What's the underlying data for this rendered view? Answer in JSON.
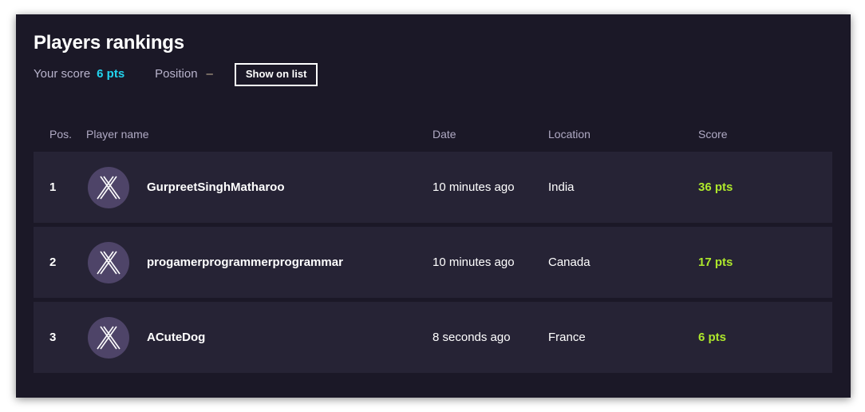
{
  "header": {
    "title": "Players rankings",
    "score_label": "Your score",
    "score_value": "6 pts",
    "position_label": "Position",
    "position_value": "–",
    "show_on_list_label": "Show on list"
  },
  "colors": {
    "page_background": "#ffffff",
    "card_background": "#1b1827",
    "row_background": "#262335",
    "accent_score_cyan": "#22d3ee",
    "accent_score_green": "#aee82c",
    "avatar_purple": "#4e4468",
    "header_text_muted": "#b0aac4"
  },
  "table": {
    "columns": [
      {
        "key": "pos",
        "label": "Pos."
      },
      {
        "key": "player",
        "label": "Player name"
      },
      {
        "key": "date",
        "label": "Date"
      },
      {
        "key": "loc",
        "label": "Location"
      },
      {
        "key": "score",
        "label": "Score"
      }
    ],
    "rows": [
      {
        "pos": "1",
        "avatar_icon": "crossed-lines-avatar-icon",
        "player": "GurpreetSinghMatharoo",
        "date": "10 minutes ago",
        "loc": "India",
        "score": "36 pts"
      },
      {
        "pos": "2",
        "avatar_icon": "crossed-lines-avatar-icon",
        "player": "progamerprogrammerprogrammar",
        "date": "10 minutes ago",
        "loc": "Canada",
        "score": "17 pts"
      },
      {
        "pos": "3",
        "avatar_icon": "crossed-lines-avatar-icon",
        "player": "ACuteDog",
        "date": "8 seconds ago",
        "loc": "France",
        "score": "6 pts"
      }
    ]
  }
}
